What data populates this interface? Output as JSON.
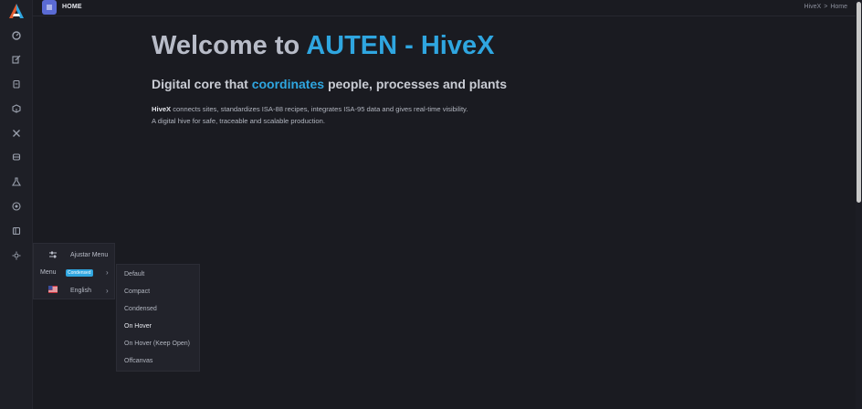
{
  "topbar": {
    "page_label": "HOME",
    "breadcrumb": {
      "root": "HiveX",
      "separator": ">",
      "current": "Home"
    }
  },
  "sidebar": {
    "icons": [
      "gauge-icon",
      "edit-icon",
      "clipboard-icon",
      "box-icon",
      "tools-icon",
      "database-icon",
      "flask-icon",
      "target-icon",
      "panel-icon",
      "sun-icon"
    ]
  },
  "hero": {
    "title_prefix": "Welcome to",
    "title_accent": "AUTEN - HiveX",
    "subtitle_before": "Digital core that",
    "subtitle_accent": "coordinates",
    "subtitle_after": "people, processes and plants",
    "desc_brand": "HiveX",
    "desc_line1": "connects sites, standardizes ISA-88 recipes, integrates ISA-95 data and gives real-time visibility.",
    "desc_line2": "A digital hive for safe, traceable and scalable production."
  },
  "settings_popover": {
    "adjust_label": "Ajustar Menu",
    "menu_label": "Menu",
    "menu_badge": "Condensed",
    "language_label": "English",
    "chevron": "›"
  },
  "menu_submenu": {
    "items": [
      "Default",
      "Compact",
      "Condensed",
      "On Hover",
      "On Hover (Keep Open)",
      "Offcanvas"
    ],
    "active": "On Hover"
  },
  "colors": {
    "accent": "#2fa6e0",
    "toggle": "#5a6bd4",
    "background": "#1a1b21"
  }
}
